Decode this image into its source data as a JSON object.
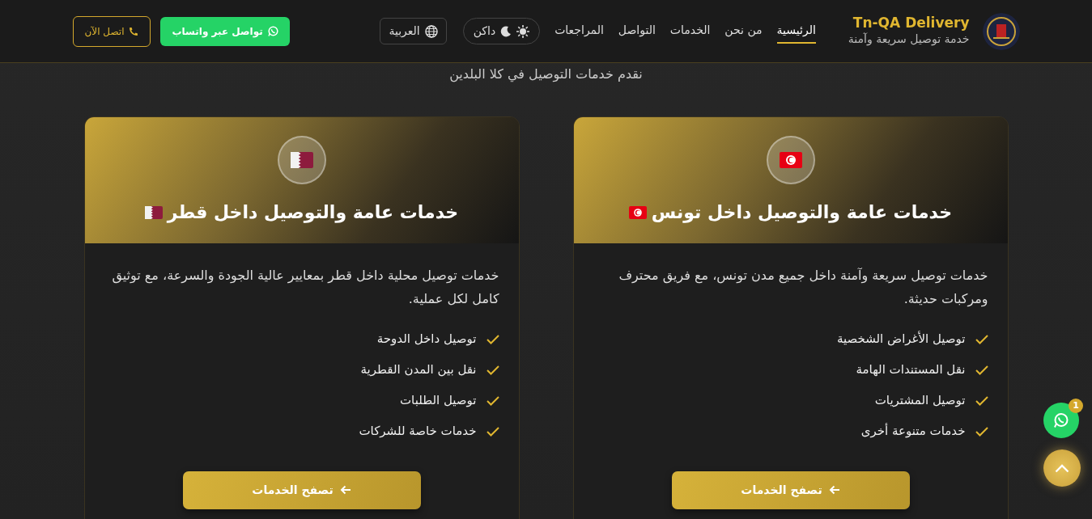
{
  "brand": {
    "title": "Tn-QA Delivery",
    "tagline": "خدمة توصيل سريعة وآمنة"
  },
  "nav": [
    {
      "label": "الرئيسية",
      "selected": true
    },
    {
      "label": "من نحن",
      "selected": false
    },
    {
      "label": "الخدمات",
      "selected": false
    },
    {
      "label": "التواصل",
      "selected": false
    },
    {
      "label": "المراجعات",
      "selected": false
    }
  ],
  "theme_toggle": {
    "label": "داكن"
  },
  "language_button": {
    "label": "العربية"
  },
  "whatsapp_button": {
    "label": "تواصل عبر واتساب"
  },
  "call_button": {
    "label": "اتصل الآن"
  },
  "subtitle": "نقدم خدمات التوصيل في كلا البلدين",
  "cards": [
    {
      "kind": "tunisia",
      "title": "خدمات عامة والتوصيل داخل تونس",
      "description": "خدمات توصيل سريعة وآمنة داخل جميع مدن تونس، مع فريق محترف ومركبات حديثة.",
      "features": [
        "توصيل الأغراض الشخصية",
        "نقل المستندات الهامة",
        "توصيل المشتريات",
        "خدمات متنوعة أخرى"
      ],
      "button": "تصفح الخدمات"
    },
    {
      "kind": "qatar",
      "title": "خدمات عامة والتوصيل داخل قطر",
      "description": "خدمات توصيل محلية داخل قطر بمعايير عالية الجودة والسرعة، مع توثيق كامل لكل عملية.",
      "features": [
        "توصيل داخل الدوحة",
        "نقل بين المدن القطرية",
        "توصيل الطلبات",
        "خدمات خاصة للشركات"
      ],
      "button": "تصفح الخدمات"
    }
  ],
  "floating_whatsapp": {
    "badge": "1"
  }
}
